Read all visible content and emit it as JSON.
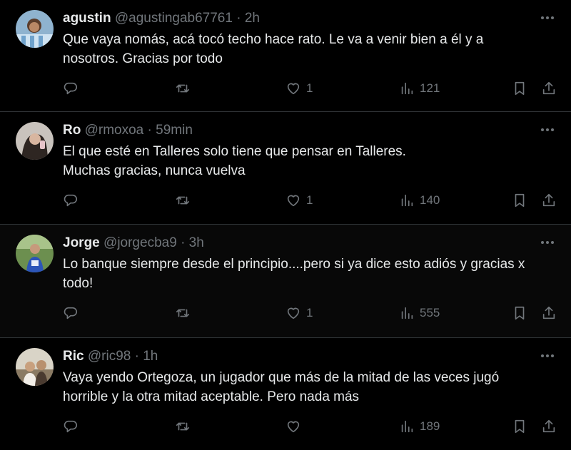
{
  "tweets": [
    {
      "name": "agustin",
      "handle": "@agustingab67761",
      "dot": "·",
      "time": "2h",
      "text": "Que vaya nomás, acá tocó techo hace rato. Le va a venir bien a él y a\nnosotros. Gracias por todo",
      "likes": "1",
      "views": "121"
    },
    {
      "name": "Ro",
      "handle": "@rmoxoa",
      "dot": "·",
      "time": "59min",
      "text": "El que esté en Talleres solo tiene que pensar en Talleres.\nMuchas gracias, nunca vuelva",
      "likes": "1",
      "views": "140"
    },
    {
      "name": "Jorge",
      "handle": "@jorgecba9",
      "dot": "·",
      "time": "3h",
      "text": "Lo banque siempre desde el principio....pero si ya dice esto adiós y gracias x\ntodo!",
      "likes": "1",
      "views": "555"
    },
    {
      "name": "Ric",
      "handle": "@ric98",
      "dot": "·",
      "time": "1h",
      "text": "Vaya yendo Ortegoza, un jugador que más de la mitad de las veces jugó\nhorrible y la otra mitad aceptable. Pero nada más",
      "likes": "",
      "views": "189"
    }
  ],
  "icons": {
    "more": "more-horizontal-icon",
    "reply": "reply-icon",
    "retweet": "retweet-icon",
    "like": "heart-icon",
    "views": "views-chart-icon",
    "bookmark": "bookmark-icon",
    "share": "share-icon"
  },
  "colors": {
    "background": "#000000",
    "text": "#e7e9ea",
    "muted": "#71767b",
    "divider": "#2f3336"
  }
}
